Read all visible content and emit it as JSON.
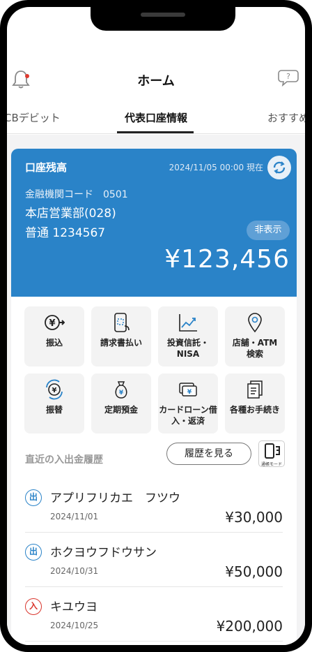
{
  "header": {
    "title": "ホーム"
  },
  "tabs": [
    {
      "label": "CBデビット"
    },
    {
      "label": "代表口座情報"
    },
    {
      "label": "おすすめ"
    }
  ],
  "account": {
    "title": "口座残高",
    "as_of": "2024/11/05 00:00 現在",
    "bank_code_line": "金融機関コード　0501",
    "branch": "本店営業部(028)",
    "account_line": "普通 1234567",
    "hide_label": "非表示",
    "balance": "¥123,456"
  },
  "actions": [
    {
      "label": "振込",
      "icon": "transfer-yen-icon"
    },
    {
      "label": "請求書払い",
      "icon": "bill-payment-icon"
    },
    {
      "label": "投資信託・NISA",
      "icon": "investment-chart-icon"
    },
    {
      "label": "店舗・ATM検索",
      "icon": "location-pin-icon"
    },
    {
      "label": "振替",
      "icon": "exchange-yen-icon"
    },
    {
      "label": "定期預金",
      "icon": "money-bag-icon"
    },
    {
      "label": "カードローン借入・返済",
      "icon": "card-loan-icon"
    },
    {
      "label": "各種お手続き",
      "icon": "documents-icon"
    }
  ],
  "history": {
    "heading": "直近の入出金履歴",
    "view_button": "履歴を見る",
    "passbook_mode_label": "通帳モード",
    "items": [
      {
        "type": "出",
        "name": "アプリフリカエ　フツウ",
        "date": "2024/11/01",
        "amount": "¥30,000"
      },
      {
        "type": "出",
        "name": "ホクヨウフドウサン",
        "date": "2024/10/31",
        "amount": "¥50,000"
      },
      {
        "type": "入",
        "name": "キユウヨ",
        "date": "2024/10/25",
        "amount": "¥200,000"
      }
    ]
  },
  "colors": {
    "accent": "#2a83c8",
    "deposit": "#d9342b",
    "withdrawal": "#2a83c8"
  }
}
